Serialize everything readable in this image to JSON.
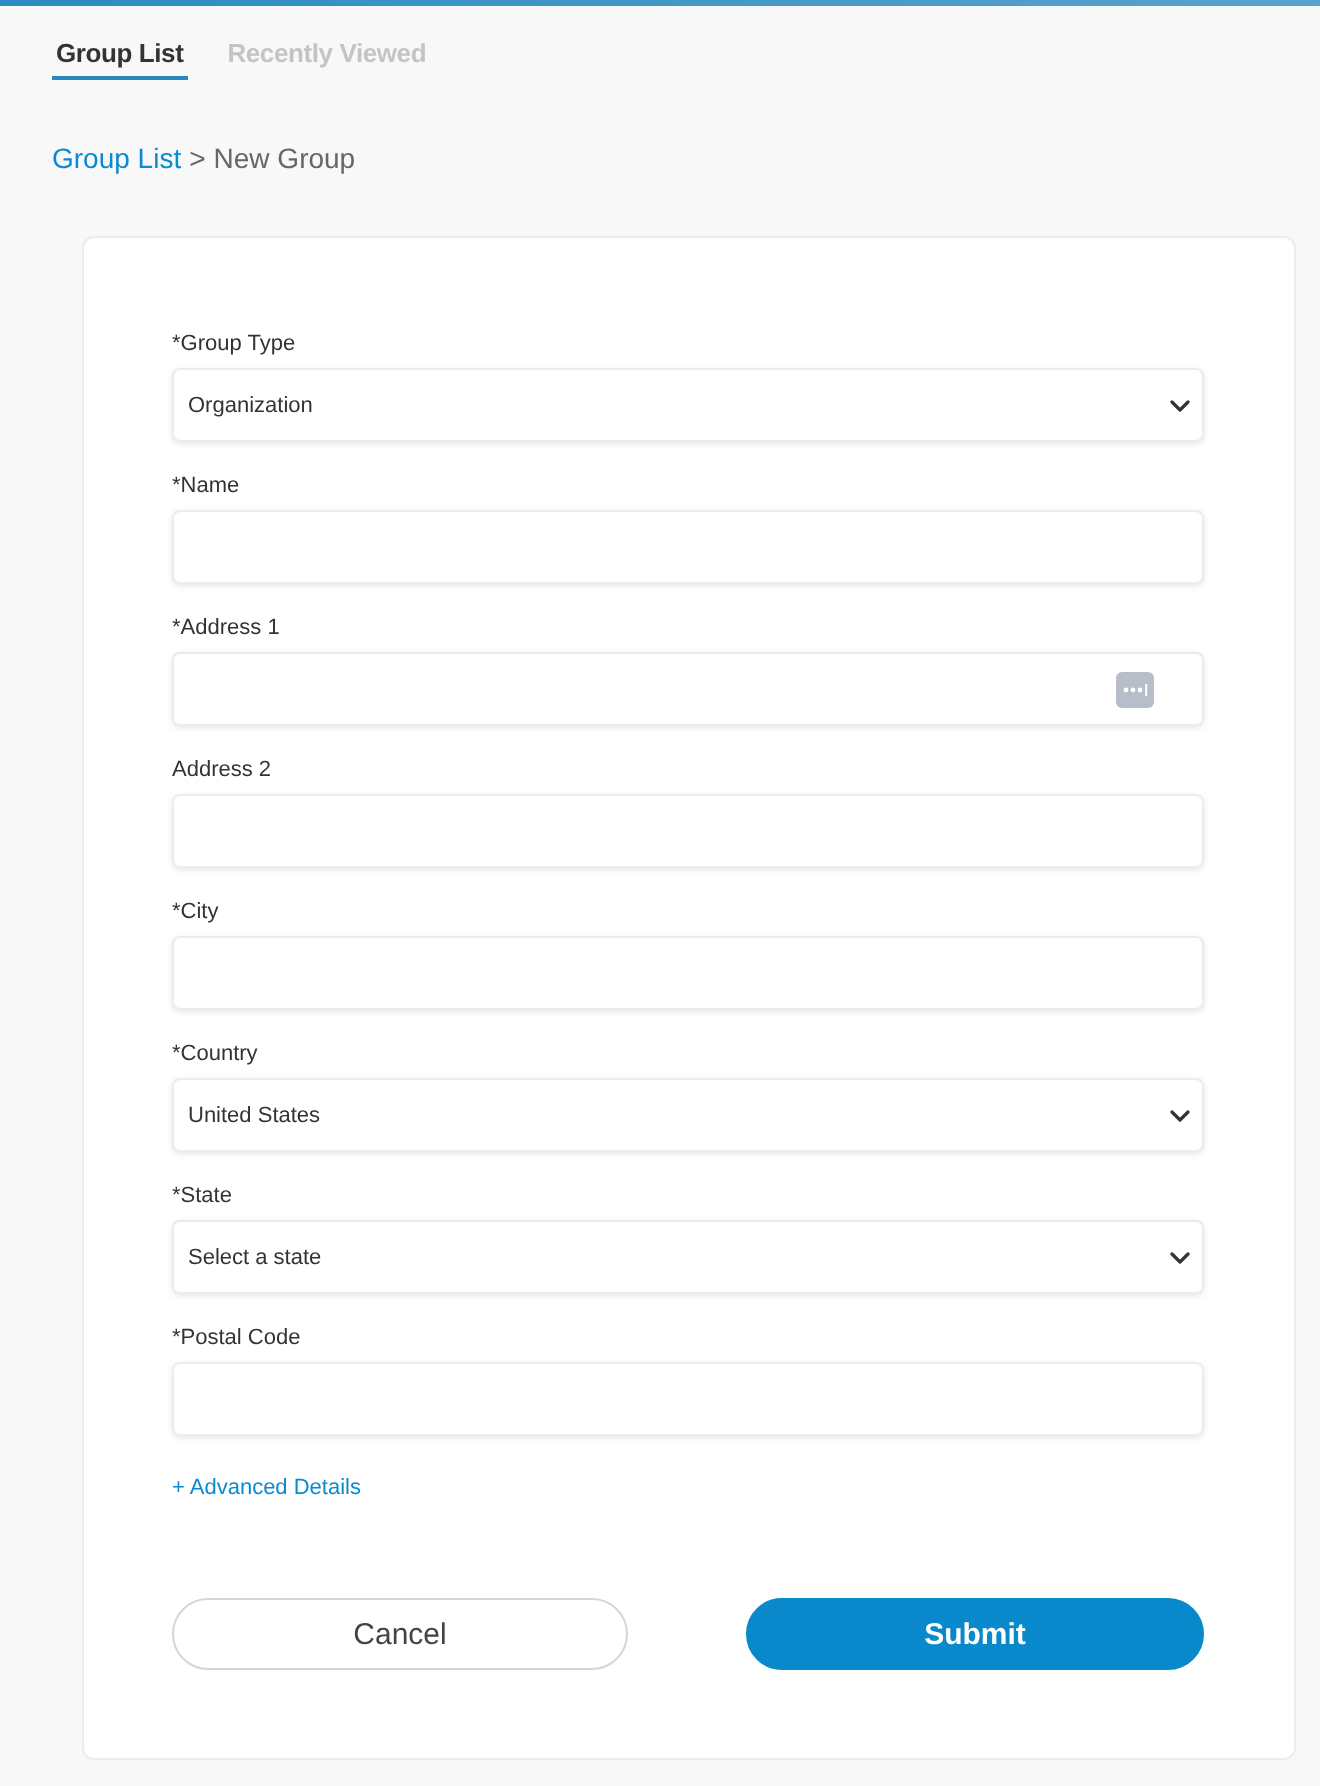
{
  "tabs": [
    {
      "label": "Group List",
      "selected": true
    },
    {
      "label": "Recently Viewed",
      "selected": false
    }
  ],
  "breadcrumb": {
    "link": "Group List",
    "separator": ">",
    "current": "New Group"
  },
  "form": {
    "fields": [
      {
        "kind": "select",
        "label": "*Group Type",
        "value": "Organization"
      },
      {
        "kind": "text",
        "label": "*Name"
      },
      {
        "kind": "text-autofill",
        "label": "*Address 1"
      },
      {
        "kind": "text",
        "label": "Address 2"
      },
      {
        "kind": "text",
        "label": "*City"
      },
      {
        "kind": "select",
        "label": "*Country",
        "value": "United States"
      },
      {
        "kind": "select",
        "label": "*State",
        "value": "Select a state"
      },
      {
        "kind": "text",
        "label": "*Postal Code"
      }
    ],
    "advanced_link": "+ Advanced Details",
    "buttons": [
      {
        "kind": "secondary",
        "label": "Cancel"
      },
      {
        "kind": "primary",
        "label": "Submit"
      }
    ]
  }
}
